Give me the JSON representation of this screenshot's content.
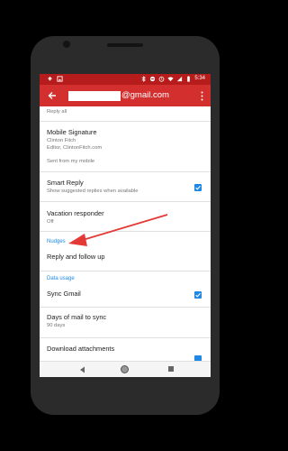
{
  "status_bar": {
    "time": "5:34",
    "left_icons": [
      "upload-icon",
      "image-icon"
    ],
    "right_icons": [
      "bluetooth-icon",
      "do-not-disturb-icon",
      "alarm-icon",
      "wifi-icon",
      "signal-icon",
      "battery-icon"
    ]
  },
  "app_bar": {
    "title": "@gmail.com",
    "color": "#d32f2f",
    "status_color": "#b71c1c"
  },
  "settings": {
    "reply_all": "Reply all",
    "mobile_signature": {
      "title": "Mobile Signature",
      "line1": "Clinton Fitch",
      "line2": "Editor, ClintonFitch.com",
      "line3": "Sent from my mobile"
    },
    "smart_reply": {
      "title": "Smart Reply",
      "subtitle": "Show suggested replies when available",
      "checked": true
    },
    "vacation": {
      "title": "Vacation responder",
      "subtitle": "Off"
    },
    "nudges_header": "Nudges",
    "reply_follow_up": "Reply and follow up",
    "data_usage_header": "Data usage",
    "sync_gmail": {
      "title": "Sync Gmail",
      "checked": true
    },
    "days_sync": {
      "title": "Days of mail to sync",
      "subtitle": "90 days"
    },
    "download_attachments": {
      "title": "Download attachments"
    }
  },
  "accent": "#1e88e5",
  "annotation_arrow_color": "#e53935"
}
